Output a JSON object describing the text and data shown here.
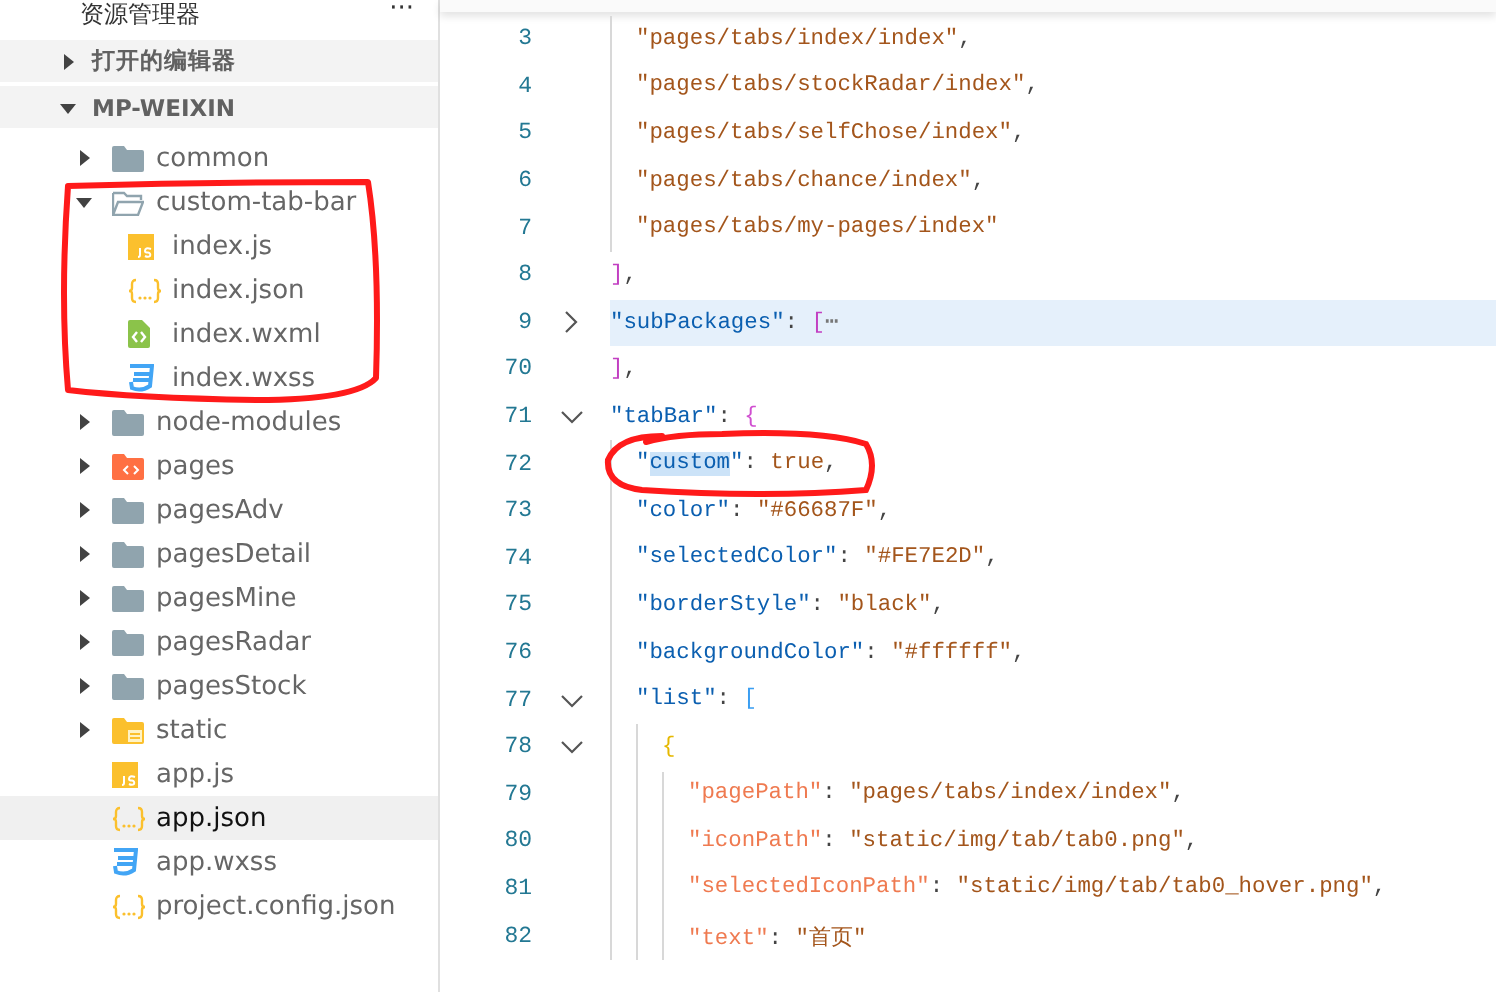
{
  "sidebar": {
    "title": "资源管理器",
    "more": "···",
    "sections": [
      {
        "label": "打开的编辑器",
        "expanded": false
      },
      {
        "label": "MP-WEIXIN",
        "expanded": true
      }
    ],
    "tree": [
      {
        "name": "common",
        "kind": "folder",
        "expanded": false,
        "selected": false,
        "circled": false
      },
      {
        "name": "custom-tab-bar",
        "kind": "folder",
        "expanded": true,
        "selected": false,
        "circled": true,
        "children": [
          {
            "name": "index.js",
            "kind": "script",
            "selected": false,
            "circled": false
          },
          {
            "name": "index.json",
            "kind": "config",
            "selected": false,
            "circled": false
          },
          {
            "name": "index.wxml",
            "kind": "markup",
            "selected": false,
            "circled": false
          },
          {
            "name": "index.wxss",
            "kind": "style",
            "selected": false,
            "circled": false
          }
        ]
      },
      {
        "name": "node-modules",
        "kind": "folder",
        "expanded": false,
        "selected": false,
        "circled": false
      },
      {
        "name": "pages",
        "kind": "codefolder",
        "expanded": false,
        "selected": false,
        "circled": false
      },
      {
        "name": "pagesAdv",
        "kind": "folder",
        "expanded": false,
        "selected": false,
        "circled": false
      },
      {
        "name": "pagesDetail",
        "kind": "folder",
        "expanded": false,
        "selected": false,
        "circled": false
      },
      {
        "name": "pagesMine",
        "kind": "folder",
        "expanded": false,
        "selected": false,
        "circled": false
      },
      {
        "name": "pagesRadar",
        "kind": "folder",
        "expanded": false,
        "selected": false,
        "circled": false
      },
      {
        "name": "pagesStock",
        "kind": "folder",
        "expanded": false,
        "selected": false,
        "circled": false
      },
      {
        "name": "static",
        "kind": "assetfolder",
        "expanded": false,
        "selected": false,
        "circled": false
      },
      {
        "name": "app.js",
        "kind": "script",
        "selected": false,
        "circled": false
      },
      {
        "name": "app.json",
        "kind": "config",
        "selected": true,
        "circled": false
      },
      {
        "name": "app.wxss",
        "kind": "style",
        "selected": false,
        "circled": false
      },
      {
        "name": "project.config.json",
        "kind": "config",
        "selected": false,
        "circled": false
      }
    ]
  },
  "editor": {
    "lines": [
      {
        "number": "3",
        "kind": "inner",
        "selected": false,
        "circled": false,
        "tokens": [
          {
            "kind": "string",
            "text": "\"pages/tabs/index/index\""
          },
          {
            "kind": "punct",
            "text": ","
          }
        ]
      },
      {
        "number": "4",
        "kind": "inner",
        "selected": false,
        "circled": false,
        "tokens": [
          {
            "kind": "string",
            "text": "\"pages/tabs/stockRadar/index\""
          },
          {
            "kind": "punct",
            "text": ","
          }
        ]
      },
      {
        "number": "5",
        "kind": "inner",
        "selected": false,
        "circled": false,
        "tokens": [
          {
            "kind": "string",
            "text": "\"pages/tabs/selfChose/index\""
          },
          {
            "kind": "punct",
            "text": ","
          }
        ]
      },
      {
        "number": "6",
        "kind": "inner",
        "selected": false,
        "circled": false,
        "tokens": [
          {
            "kind": "string",
            "text": "\"pages/tabs/chance/index\""
          },
          {
            "kind": "punct",
            "text": ","
          }
        ]
      },
      {
        "number": "7",
        "kind": "inner",
        "selected": false,
        "circled": false,
        "tokens": [
          {
            "kind": "string",
            "text": "\"pages/tabs/my-pages/index\""
          }
        ]
      },
      {
        "number": "8",
        "kind": "root",
        "selected": false,
        "circled": false,
        "tokens": [
          {
            "kind": "bracket",
            "text": "]",
            "color": "#c23fc2"
          },
          {
            "kind": "punct",
            "text": ","
          }
        ]
      },
      {
        "number": "9",
        "kind": "root",
        "expanded": false,
        "selected": true,
        "circled": false,
        "tokens": [
          {
            "kind": "key",
            "text": "\"subPackages\""
          },
          {
            "kind": "punct",
            "text": ": "
          },
          {
            "kind": "bracket",
            "text": "[",
            "color": "#c23fc2"
          },
          {
            "kind": "ellipsis",
            "text": "⋯"
          }
        ]
      },
      {
        "number": "70",
        "kind": "root",
        "selected": false,
        "circled": false,
        "tokens": [
          {
            "kind": "bracket",
            "text": "]",
            "color": "#c23fc2"
          },
          {
            "kind": "punct",
            "text": ","
          }
        ]
      },
      {
        "number": "71",
        "kind": "root",
        "expanded": true,
        "selected": false,
        "circled": false,
        "tokens": [
          {
            "kind": "key",
            "text": "\"tabBar\""
          },
          {
            "kind": "punct",
            "text": ": "
          },
          {
            "kind": "bracket",
            "text": "{",
            "color": "#d04fd0"
          }
        ]
      },
      {
        "number": "72",
        "kind": "inner",
        "selected": false,
        "circled": true,
        "tokens": [
          {
            "kind": "key",
            "text": "\""
          },
          {
            "kind": "match",
            "text": "custom"
          },
          {
            "kind": "key",
            "text": "\""
          },
          {
            "kind": "punct",
            "text": ": "
          },
          {
            "kind": "bool",
            "text": "true"
          },
          {
            "kind": "punct",
            "text": ","
          }
        ]
      },
      {
        "number": "73",
        "kind": "inner",
        "selected": false,
        "circled": false,
        "tokens": [
          {
            "kind": "key",
            "text": "\"color\""
          },
          {
            "kind": "punct",
            "text": ": "
          },
          {
            "kind": "string",
            "text": "\"#66687F\""
          },
          {
            "kind": "punct",
            "text": ","
          }
        ]
      },
      {
        "number": "74",
        "kind": "inner",
        "selected": false,
        "circled": false,
        "tokens": [
          {
            "kind": "key",
            "text": "\"selectedColor\""
          },
          {
            "kind": "punct",
            "text": ": "
          },
          {
            "kind": "string",
            "text": "\"#FE7E2D\""
          },
          {
            "kind": "punct",
            "text": ","
          }
        ]
      },
      {
        "number": "75",
        "kind": "inner",
        "selected": false,
        "circled": false,
        "tokens": [
          {
            "kind": "key",
            "text": "\"borderStyle\""
          },
          {
            "kind": "punct",
            "text": ": "
          },
          {
            "kind": "string",
            "text": "\"black\""
          },
          {
            "kind": "punct",
            "text": ","
          }
        ]
      },
      {
        "number": "76",
        "kind": "inner",
        "selected": false,
        "circled": false,
        "tokens": [
          {
            "kind": "key",
            "text": "\"backgroundColor\""
          },
          {
            "kind": "punct",
            "text": ": "
          },
          {
            "kind": "string",
            "text": "\"#ffffff\""
          },
          {
            "kind": "punct",
            "text": ","
          }
        ]
      },
      {
        "number": "77",
        "kind": "inner",
        "expanded": true,
        "selected": false,
        "circled": false,
        "tokens": [
          {
            "kind": "key",
            "text": "\"list\""
          },
          {
            "kind": "punct",
            "text": ": "
          },
          {
            "kind": "bracket",
            "text": "[",
            "color": "#3a9ef2"
          }
        ]
      },
      {
        "number": "78",
        "kind": "item",
        "expanded": true,
        "selected": false,
        "circled": false,
        "tokens": [
          {
            "kind": "bracket",
            "text": "{",
            "color": "#e6b800"
          }
        ]
      },
      {
        "number": "79",
        "kind": "field",
        "selected": false,
        "circled": false,
        "tokens": [
          {
            "kind": "key2",
            "text": "\"pagePath\""
          },
          {
            "kind": "punct",
            "text": ": "
          },
          {
            "kind": "string",
            "text": "\"pages/tabs/index/index\""
          },
          {
            "kind": "punct",
            "text": ","
          }
        ]
      },
      {
        "number": "80",
        "kind": "field",
        "selected": false,
        "circled": false,
        "tokens": [
          {
            "kind": "key2",
            "text": "\"iconPath\""
          },
          {
            "kind": "punct",
            "text": ": "
          },
          {
            "kind": "string",
            "text": "\"static/img/tab/tab0.png\""
          },
          {
            "kind": "punct",
            "text": ","
          }
        ]
      },
      {
        "number": "81",
        "kind": "field",
        "selected": false,
        "circled": false,
        "tokens": [
          {
            "kind": "key2",
            "text": "\"selectedIconPath\""
          },
          {
            "kind": "punct",
            "text": ": "
          },
          {
            "kind": "string",
            "text": "\"static/img/tab/tab0_hover.png\""
          },
          {
            "kind": "punct",
            "text": ","
          }
        ]
      },
      {
        "number": "82",
        "kind": "field",
        "selected": false,
        "circled": false,
        "tokens": [
          {
            "kind": "key2",
            "text": "\"text\""
          },
          {
            "kind": "punct",
            "text": ": "
          },
          {
            "kind": "string",
            "text": "\"首页\""
          }
        ]
      }
    ]
  }
}
